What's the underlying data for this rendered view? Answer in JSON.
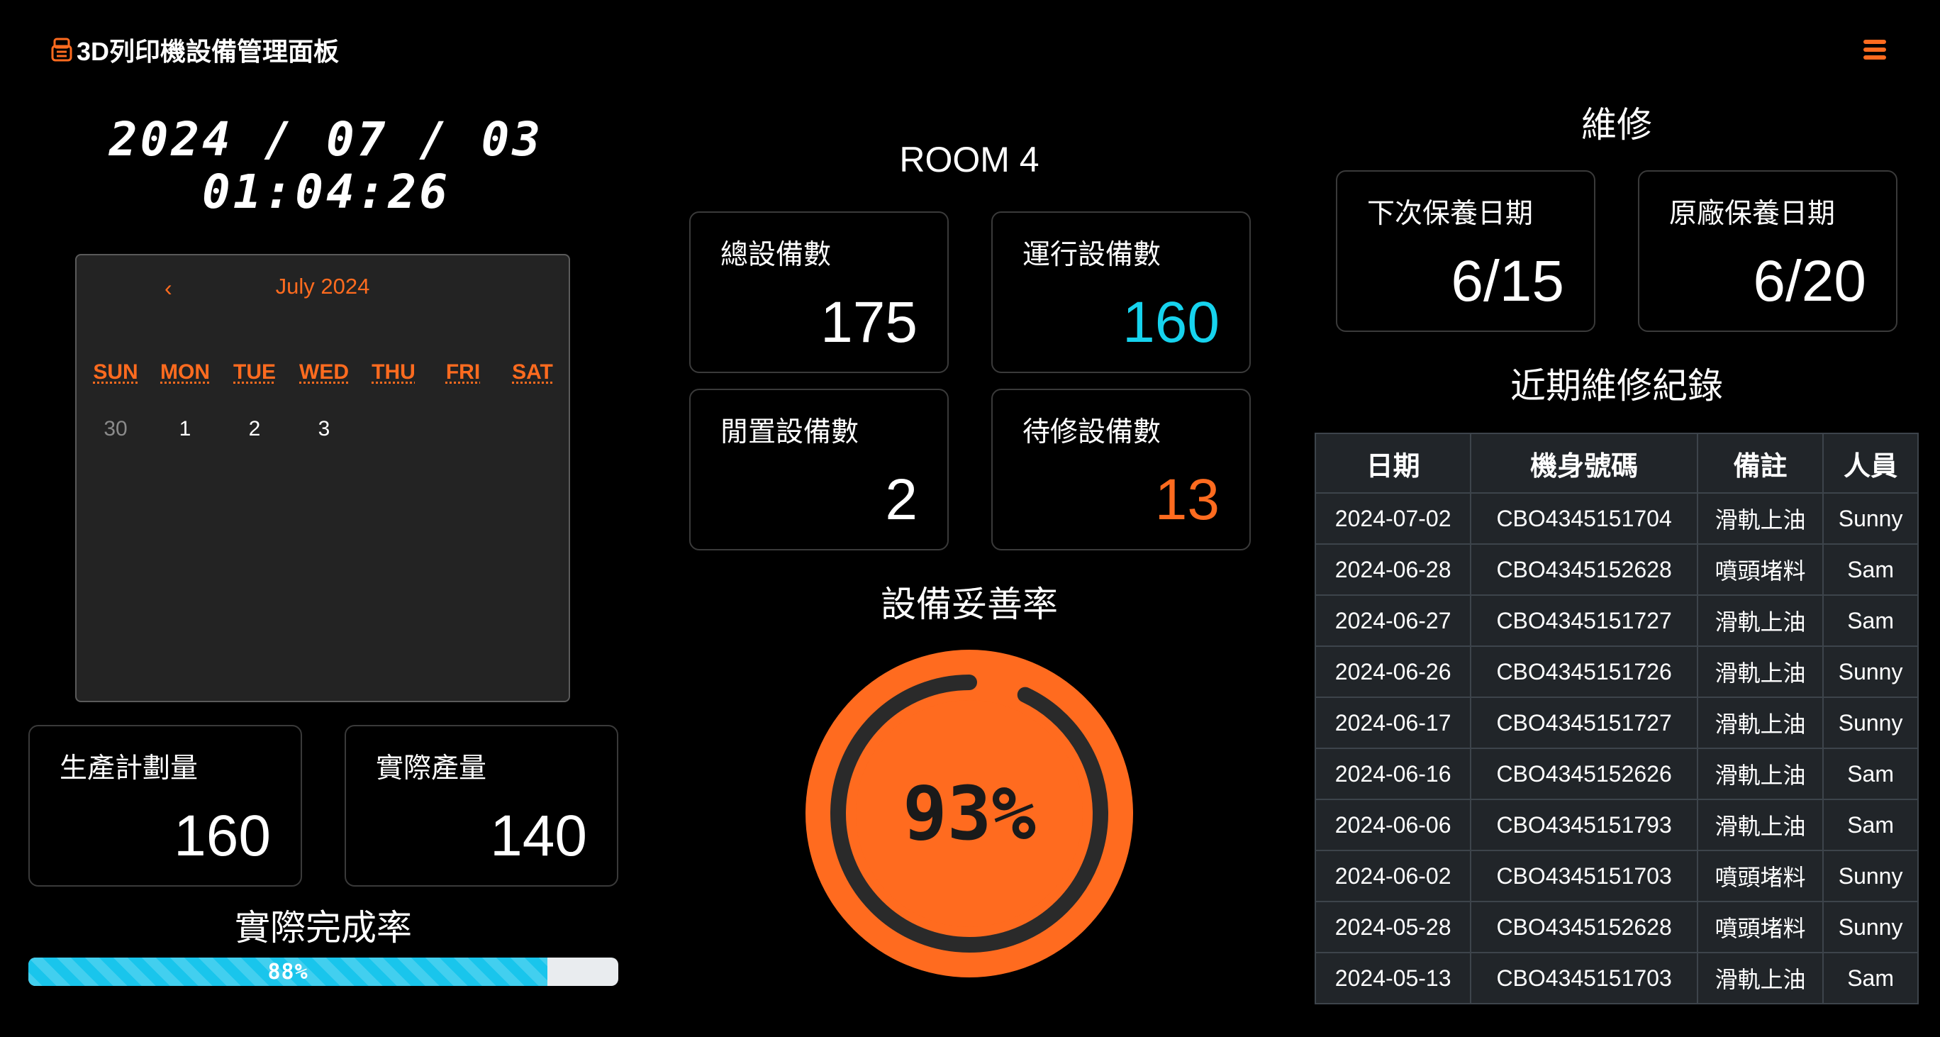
{
  "header": {
    "title": "3D列印機設備管理面板",
    "brand_icon": "printer-icon",
    "menu_icon": "hamburger-menu-icon"
  },
  "clock": {
    "date": "2024 / 07 / 03",
    "time": "01:04:26"
  },
  "calendar": {
    "prev": "‹",
    "month": "July 2024",
    "weekdays": [
      "SUN",
      "MON",
      "TUE",
      "WED",
      "THU",
      "FRI",
      "SAT"
    ],
    "days": [
      "30",
      "1",
      "2",
      "3"
    ]
  },
  "production": {
    "planned_label": "生產計劃量",
    "planned_value": "160",
    "actual_label": "實際產量",
    "actual_value": "140",
    "rate_title": "實際完成率",
    "rate_text": "88%",
    "rate_value": 0.88
  },
  "room": {
    "name": "ROOM 4",
    "total_label": "總設備數",
    "total_value": "175",
    "running_label": "運行設備數",
    "running_value": "160",
    "idle_label": "閒置設備數",
    "idle_value": "2",
    "repair_label": "待修設備數",
    "repair_value": "13"
  },
  "availability": {
    "title": "設備妥善率",
    "text": "93%",
    "value": 0.93
  },
  "maintenance": {
    "title": "維修",
    "next_label": "下次保養日期",
    "next_value": "6/15",
    "vendor_label": "原廠保養日期",
    "vendor_value": "6/20",
    "records_title": "近期維修紀錄",
    "columns": [
      "日期",
      "機身號碼",
      "備註",
      "人員"
    ],
    "rows": [
      [
        "2024-07-02",
        "CBO4345151704",
        "滑軌上油",
        "Sunny"
      ],
      [
        "2024-06-28",
        "CBO4345152628",
        "噴頭堵料",
        "Sam"
      ],
      [
        "2024-06-27",
        "CBO4345151727",
        "滑軌上油",
        "Sam"
      ],
      [
        "2024-06-26",
        "CBO4345151726",
        "滑軌上油",
        "Sunny"
      ],
      [
        "2024-06-17",
        "CBO4345151727",
        "滑軌上油",
        "Sunny"
      ],
      [
        "2024-06-16",
        "CBO4345152626",
        "滑軌上油",
        "Sam"
      ],
      [
        "2024-06-06",
        "CBO4345151793",
        "滑軌上油",
        "Sam"
      ],
      [
        "2024-06-02",
        "CBO4345151703",
        "噴頭堵料",
        "Sunny"
      ],
      [
        "2024-05-28",
        "CBO4345152628",
        "噴頭堵料",
        "Sunny"
      ],
      [
        "2024-05-13",
        "CBO4345151703",
        "滑軌上油",
        "Sam"
      ]
    ]
  },
  "colors": {
    "accent": "#ff6b1f",
    "cyan": "#16d3ee",
    "progress": "#19c5ec"
  }
}
